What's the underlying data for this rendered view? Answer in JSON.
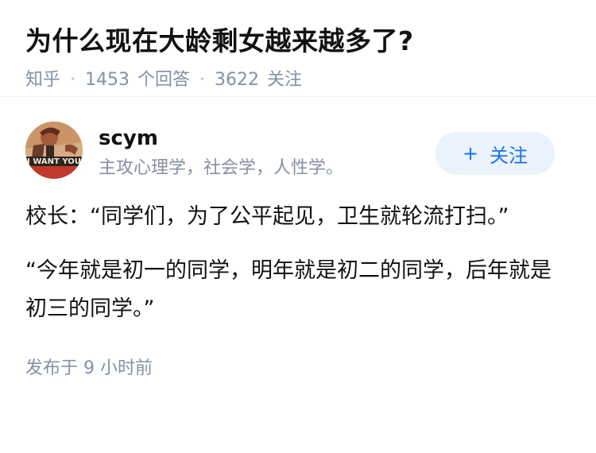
{
  "question": {
    "title": "为什么现在大龄剩女越来越多了?",
    "source": "知乎",
    "answer_count": "1453",
    "answer_label": "个回答",
    "follower_count": "3622",
    "follower_label": "关注"
  },
  "author": {
    "name": "scym",
    "bio": "主攻心理学，社会学，人性学。",
    "avatar_text": "I WANT YOU",
    "follow_plus": "+",
    "follow_label": "关注"
  },
  "answer": {
    "paragraphs": [
      "校长：“同学们，为了公平起见，卫生就轮流打扫。”",
      "“今年就是初一的同学，明年就是初二的同学，后年就是初三的同学。”"
    ],
    "published": "发布于 9 小时前"
  },
  "colors": {
    "meta_gray": "#8590a6",
    "accent_blue": "#1772f6",
    "follow_bg": "#eaf2fb"
  }
}
